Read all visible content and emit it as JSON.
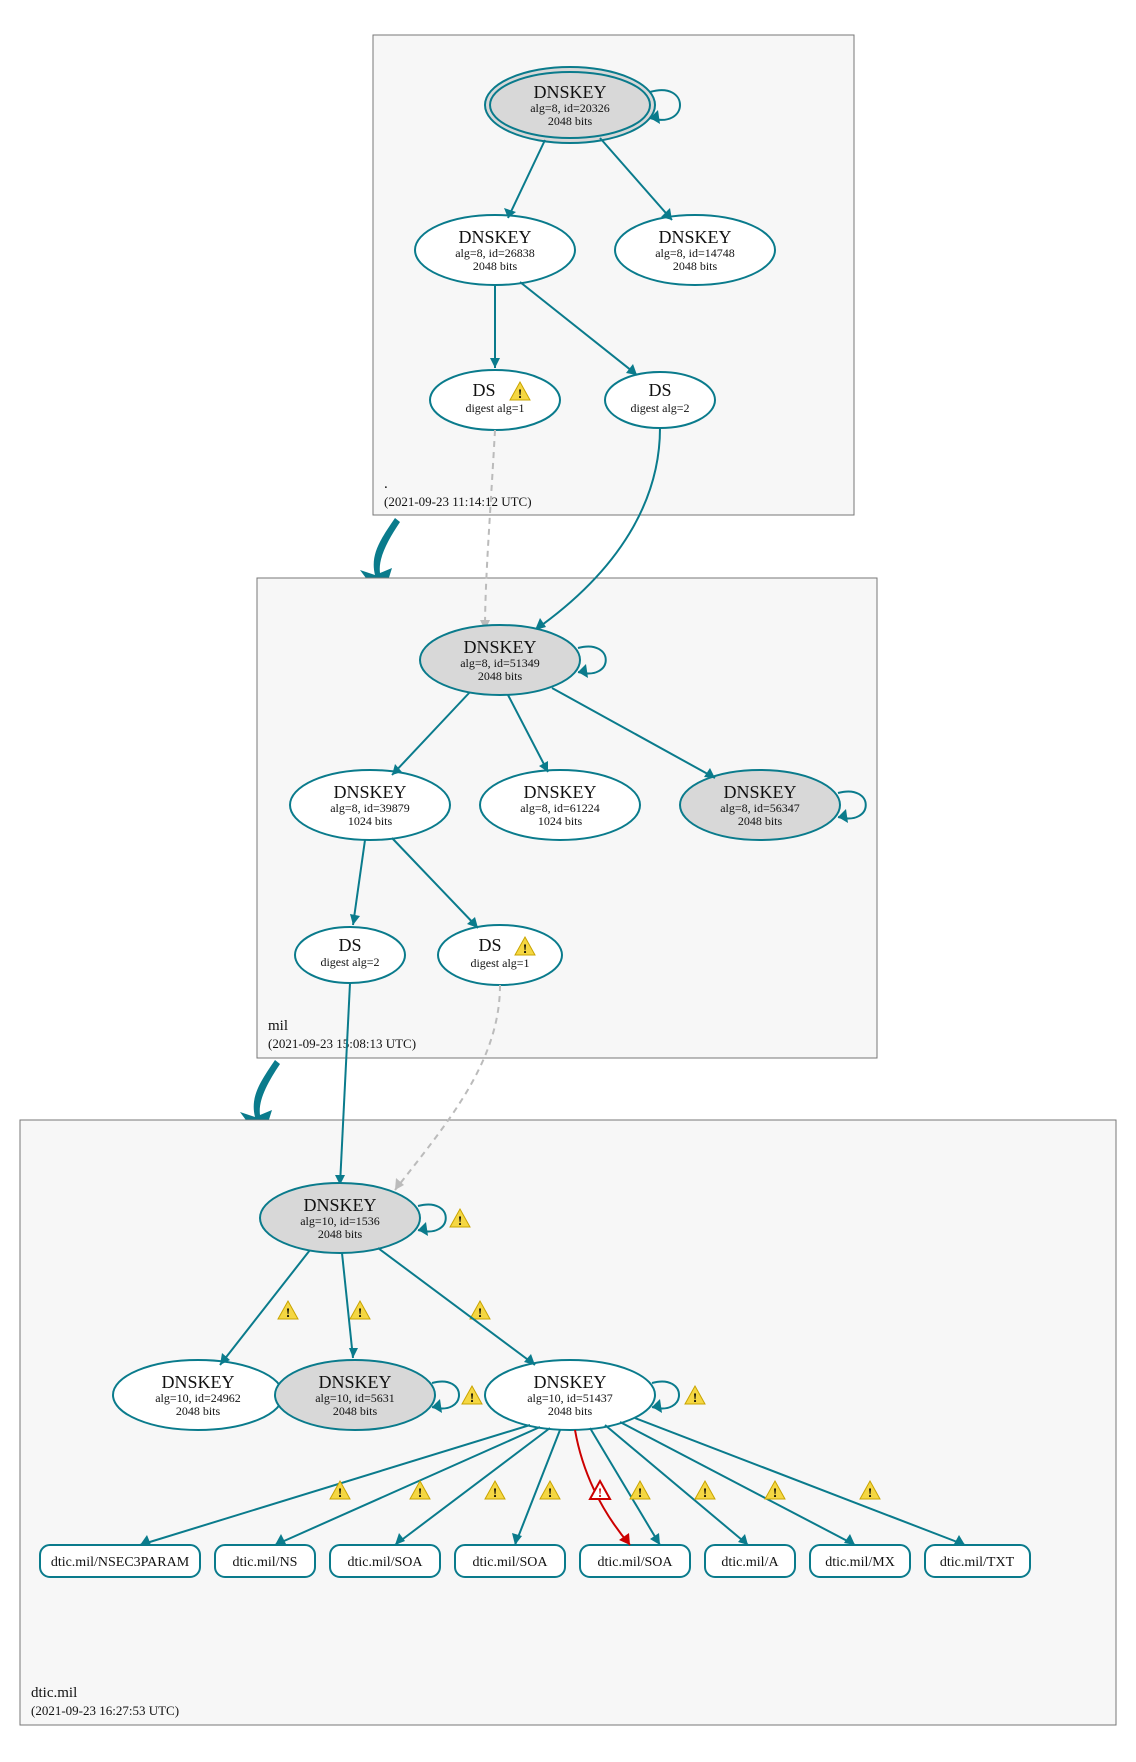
{
  "colors": {
    "teal": "#0a7b8c",
    "grey_fill": "#d8d8d8",
    "zone_bg": "#f7f7f7",
    "warn_fill": "#f5d742",
    "err_stroke": "#cc0000"
  },
  "zones": {
    "root": {
      "name": ".",
      "timestamp": "(2021-09-23 11:14:12 UTC)"
    },
    "mil": {
      "name": "mil",
      "timestamp": "(2021-09-23 15:08:13 UTC)"
    },
    "dtic": {
      "name": "dtic.mil",
      "timestamp": "(2021-09-23 16:27:53 UTC)"
    }
  },
  "nodes": {
    "root_ksk": {
      "title": "DNSKEY",
      "line2": "alg=8, id=20326",
      "line3": "2048 bits"
    },
    "root_k1": {
      "title": "DNSKEY",
      "line2": "alg=8, id=26838",
      "line3": "2048 bits"
    },
    "root_k2": {
      "title": "DNSKEY",
      "line2": "alg=8, id=14748",
      "line3": "2048 bits"
    },
    "root_ds1": {
      "title": "DS",
      "line2": "digest alg=1",
      "warn": true
    },
    "root_ds2": {
      "title": "DS",
      "line2": "digest alg=2"
    },
    "mil_ksk": {
      "title": "DNSKEY",
      "line2": "alg=8, id=51349",
      "line3": "2048 bits"
    },
    "mil_k1": {
      "title": "DNSKEY",
      "line2": "alg=8, id=39879",
      "line3": "1024 bits"
    },
    "mil_k2": {
      "title": "DNSKEY",
      "line2": "alg=8, id=61224",
      "line3": "1024 bits"
    },
    "mil_k3": {
      "title": "DNSKEY",
      "line2": "alg=8, id=56347",
      "line3": "2048 bits"
    },
    "mil_ds2": {
      "title": "DS",
      "line2": "digest alg=2"
    },
    "mil_ds1": {
      "title": "DS",
      "line2": "digest alg=1",
      "warn": true
    },
    "dtic_ksk": {
      "title": "DNSKEY",
      "line2": "alg=10, id=1536",
      "line3": "2048 bits"
    },
    "dtic_k1": {
      "title": "DNSKEY",
      "line2": "alg=10, id=24962",
      "line3": "2048 bits"
    },
    "dtic_k2": {
      "title": "DNSKEY",
      "line2": "alg=10, id=5631",
      "line3": "2048 bits"
    },
    "dtic_k3": {
      "title": "DNSKEY",
      "line2": "alg=10, id=51437",
      "line3": "2048 bits"
    }
  },
  "rrsets": {
    "r0": "dtic.mil/NSEC3PARAM",
    "r1": "dtic.mil/NS",
    "r2": "dtic.mil/SOA",
    "r3": "dtic.mil/SOA",
    "r4": "dtic.mil/SOA",
    "r5": "dtic.mil/A",
    "r6": "dtic.mil/MX",
    "r7": "dtic.mil/TXT"
  }
}
